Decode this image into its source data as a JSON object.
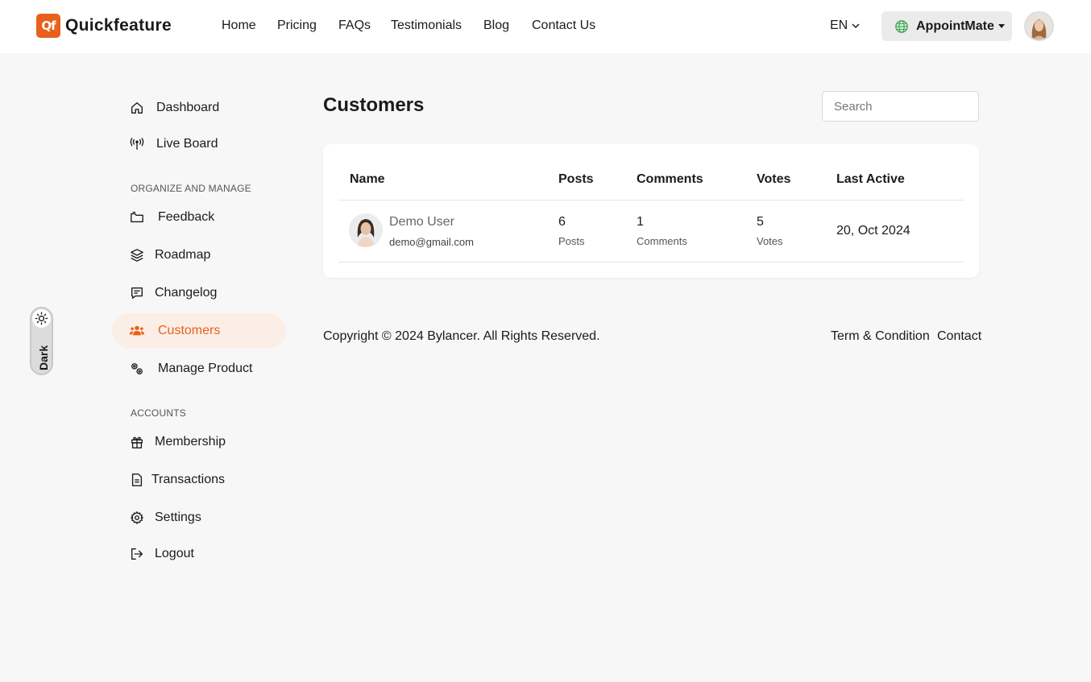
{
  "brand": {
    "logo_mark": "Qf",
    "name": "Quickfeature",
    "accent": "#e8601c"
  },
  "nav": [
    {
      "label": "Home"
    },
    {
      "label": "Pricing"
    },
    {
      "label": "FAQs"
    },
    {
      "label": "Testimonials"
    },
    {
      "label": "Blog"
    },
    {
      "label": "Contact Us"
    }
  ],
  "header": {
    "language": "EN",
    "workspace": "AppointMate"
  },
  "sidebar": {
    "items_top": [
      {
        "label": "Dashboard",
        "icon": "home-icon"
      },
      {
        "label": "Live Board",
        "icon": "broadcast-icon"
      }
    ],
    "section_organize": "ORGANIZE AND MANAGE",
    "items_organize": [
      {
        "label": "Feedback",
        "icon": "folder-icon"
      },
      {
        "label": "Roadmap",
        "icon": "layers-icon"
      },
      {
        "label": "Changelog",
        "icon": "message-icon"
      },
      {
        "label": "Customers",
        "icon": "users-icon",
        "active": true
      },
      {
        "label": "Manage Product",
        "icon": "gears-icon"
      }
    ],
    "section_accounts": "ACCOUNTS",
    "items_accounts": [
      {
        "label": "Membership",
        "icon": "gift-icon"
      },
      {
        "label": "Transactions",
        "icon": "document-icon"
      },
      {
        "label": "Settings",
        "icon": "gear-icon"
      },
      {
        "label": "Logout",
        "icon": "logout-icon"
      }
    ]
  },
  "theme_toggle": {
    "label": "Dark"
  },
  "main": {
    "title": "Customers",
    "search_placeholder": "Search"
  },
  "table": {
    "columns": [
      "Name",
      "Posts",
      "Comments",
      "Votes",
      "Last Active"
    ],
    "rows": [
      {
        "name": "Demo User",
        "email": "demo@gmail.com",
        "posts": "6",
        "posts_label": "Posts",
        "comments": "1",
        "comments_label": "Comments",
        "votes": "5",
        "votes_label": "Votes",
        "last_active": "20, Oct 2024"
      }
    ]
  },
  "footer": {
    "copyright": "Copyright © 2024 Bylancer. All Rights Reserved.",
    "links": [
      "Term & Condition",
      "Contact"
    ]
  }
}
